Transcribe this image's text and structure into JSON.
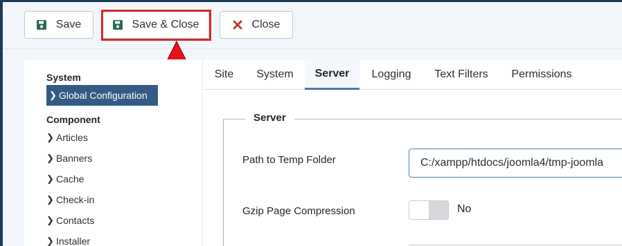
{
  "toolbar": {
    "save_label": "Save",
    "save_close_label": "Save & Close",
    "close_label": "Close"
  },
  "sidebar": {
    "system_heading": "System",
    "global_config": "Global Configuration",
    "component_heading": "Component",
    "items": [
      "Articles",
      "Banners",
      "Cache",
      "Check-in",
      "Contacts",
      "Installer"
    ]
  },
  "tabs": [
    "Site",
    "System",
    "Server",
    "Logging",
    "Text Filters",
    "Permissions"
  ],
  "active_tab": "Server",
  "server": {
    "legend": "Server",
    "temp_path_label": "Path to Temp Folder",
    "temp_path_value": "C:/xampp/htdocs/joomla4/tmp-joomla",
    "gzip_label": "Gzip Page Compression",
    "gzip_value": "No"
  },
  "colors": {
    "accent": "#335b86",
    "highlight": "#d12a2a",
    "save_icon": "#2d6a4f",
    "close_icon": "#c0392b"
  },
  "icons": {
    "save": "floppy-disk-icon",
    "close": "x-icon",
    "chevron": "chevron-right-icon"
  }
}
